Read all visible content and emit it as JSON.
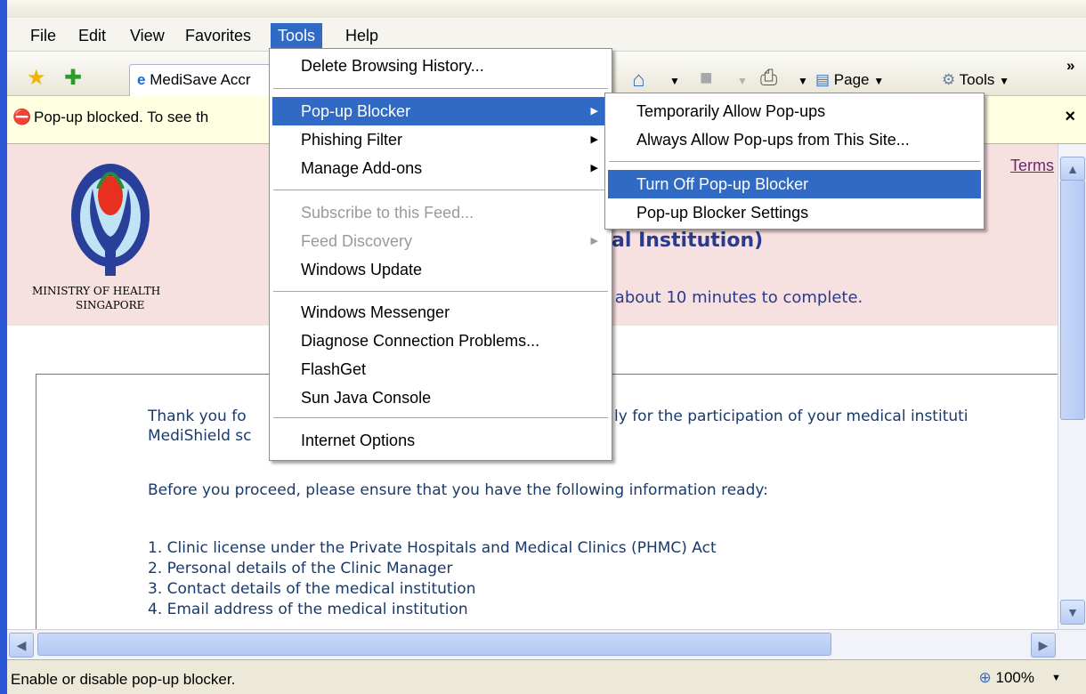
{
  "menubar": {
    "items": [
      "File",
      "Edit",
      "View",
      "Favorites",
      "Tools",
      "Help"
    ]
  },
  "toolbar": {
    "tab_title": "MediSave Accr",
    "page_label": "Page",
    "tools_label": "Tools",
    "chevron": "»"
  },
  "infobar": {
    "text": "Pop-up blocked. To see th",
    "close": "×"
  },
  "page": {
    "terms_link": "Terms",
    "heading_fragment": "cal Institution)",
    "minutes_fragment": "e about 10 minutes to complete.",
    "org_line1": "MINISTRY OF HEALTH",
    "org_line2": "SINGAPORE",
    "thank_you_start": "Thank you fo",
    "thank_you_end": "ly for the participation of your medical instituti",
    "medishield": "MediShield sc",
    "proceed": "Before you proceed, please ensure that you have the following information ready:",
    "list": [
      "1. Clinic license under the Private Hospitals and Medical Clinics (PHMC) Act",
      "2. Personal details of the Clinic Manager",
      "3. Contact details of the medical institution",
      "4. Email address of the medical institution"
    ]
  },
  "tools_menu": {
    "items": [
      {
        "label": "Delete Browsing History...",
        "enabled": true
      },
      {
        "label": "Pop-up Blocker",
        "enabled": true,
        "submenu": true,
        "highlighted": true
      },
      {
        "label": "Phishing Filter",
        "enabled": true,
        "submenu": true
      },
      {
        "label": "Manage Add-ons",
        "enabled": true,
        "submenu": true
      },
      {
        "label": "Subscribe to this Feed...",
        "enabled": false
      },
      {
        "label": "Feed Discovery",
        "enabled": false,
        "submenu": true
      },
      {
        "label": "Windows Update",
        "enabled": true
      },
      {
        "label": "Windows Messenger",
        "enabled": true
      },
      {
        "label": "Diagnose Connection Problems...",
        "enabled": true
      },
      {
        "label": "FlashGet",
        "enabled": true
      },
      {
        "label": "Sun Java Console",
        "enabled": true
      },
      {
        "label": "Internet Options",
        "enabled": true
      }
    ]
  },
  "popup_submenu": {
    "items": [
      {
        "label": "Temporarily Allow Pop-ups"
      },
      {
        "label": "Always Allow Pop-ups from This Site..."
      },
      {
        "label": "Turn Off Pop-up Blocker",
        "highlighted": true
      },
      {
        "label": "Pop-up Blocker Settings"
      }
    ]
  },
  "statusbar": {
    "text": "Enable or disable pop-up blocker.",
    "zoom": "100%"
  },
  "colors": {
    "highlight": "#316ac5",
    "pink_band": "#f7e0e0",
    "heading_blue": "#2a3a8c"
  }
}
